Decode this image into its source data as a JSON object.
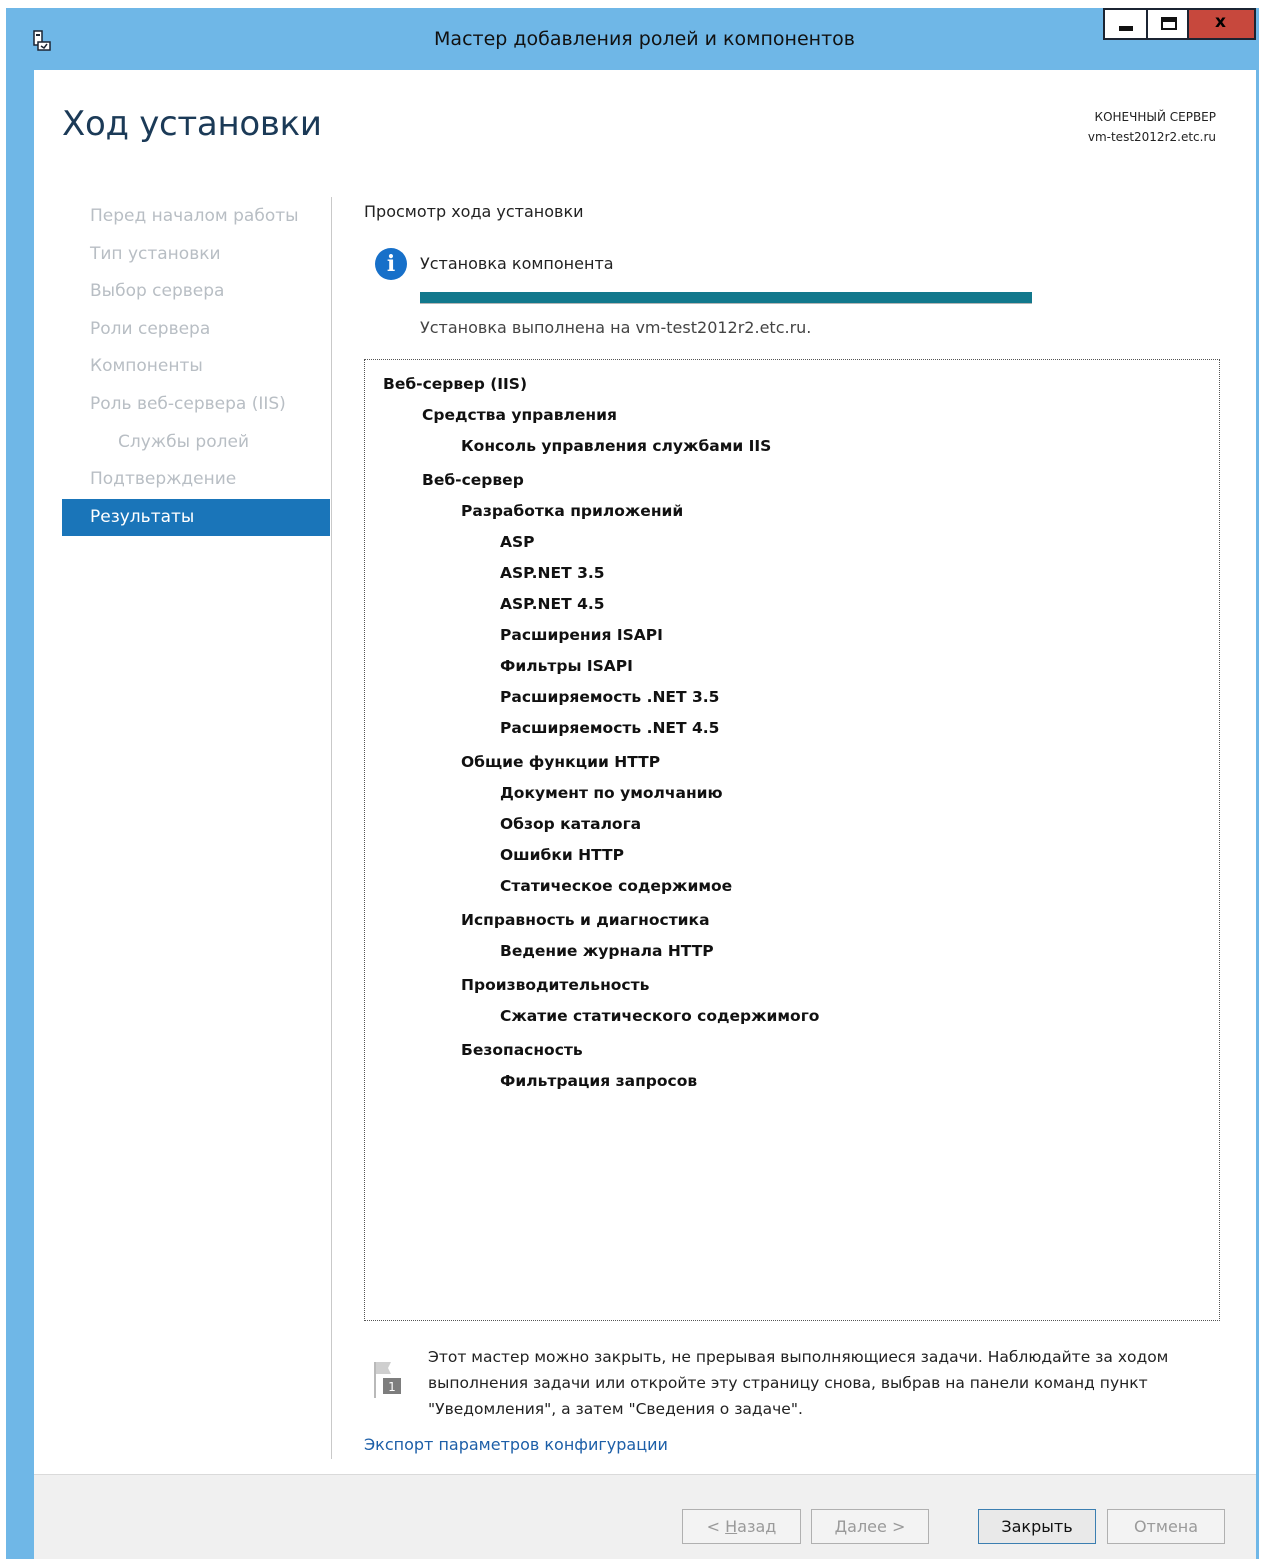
{
  "window": {
    "title": "Мастер добавления ролей и компонентов",
    "close_glyph": "x",
    "icon": "server-manager-icon"
  },
  "header": {
    "page_title": "Ход установки",
    "server_label": "КОНЕЧНЫЙ СЕРВЕР",
    "server_name": "vm-test2012r2.etc.ru"
  },
  "nav": {
    "items": [
      {
        "label": "Перед началом работы"
      },
      {
        "label": "Тип установки"
      },
      {
        "label": "Выбор сервера"
      },
      {
        "label": "Роли сервера"
      },
      {
        "label": "Компоненты"
      },
      {
        "label": "Роль веб-сервера (IIS)"
      },
      {
        "label": "Службы ролей"
      },
      {
        "label": "Подтверждение"
      },
      {
        "label": "Результаты"
      }
    ]
  },
  "main": {
    "section_heading": "Просмотр хода установки",
    "status_title": "Установка компонента",
    "status_detail": "Установка выполнена на vm-test2012r2.etc.ru.",
    "progress_fraction": 1.0,
    "progress_color": "#12788c",
    "tree": [
      "Веб-сервер (IIS)",
      "Средства управления",
      "Консоль управления службами IIS",
      "Веб-сервер",
      "Разработка приложений",
      "ASP",
      "ASP.NET 3.5",
      "ASP.NET 4.5",
      "Расширения ISAPI",
      "Фильтры ISAPI",
      "Расширяемость .NET 3.5",
      "Расширяемость .NET 4.5",
      "Общие функции HTTP",
      "Документ по умолчанию",
      "Обзор каталога",
      "Ошибки HTTP",
      "Статическое содержимое",
      "Исправность и диагностика",
      "Ведение журнала HTTP",
      "Производительность",
      "Сжатие статического содержимого",
      "Безопасность",
      "Фильтрация запросов"
    ],
    "note": "Этот мастер можно закрыть, не прерывая выполняющиеся задачи. Наблюдайте за ходом выполнения задачи или откройте эту страницу снова, выбрав на панели команд пункт \"Уведомления\", а затем \"Сведения о задаче\".",
    "notification_badge": "1",
    "export_link": "Экспорт параметров конфигурации"
  },
  "footer": {
    "back_prefix": "< ",
    "back_key": "Н",
    "back_rest": "азад",
    "next_key": "Д",
    "next_rest": "алее >",
    "close": "Закрыть",
    "cancel": "Отмена"
  },
  "colors": {
    "window_frame": "#6fb7e7",
    "nav_active": "#1a75b9",
    "close_button": "#c7483d",
    "info_icon": "#1770c9",
    "link": "#1d5fa8"
  }
}
